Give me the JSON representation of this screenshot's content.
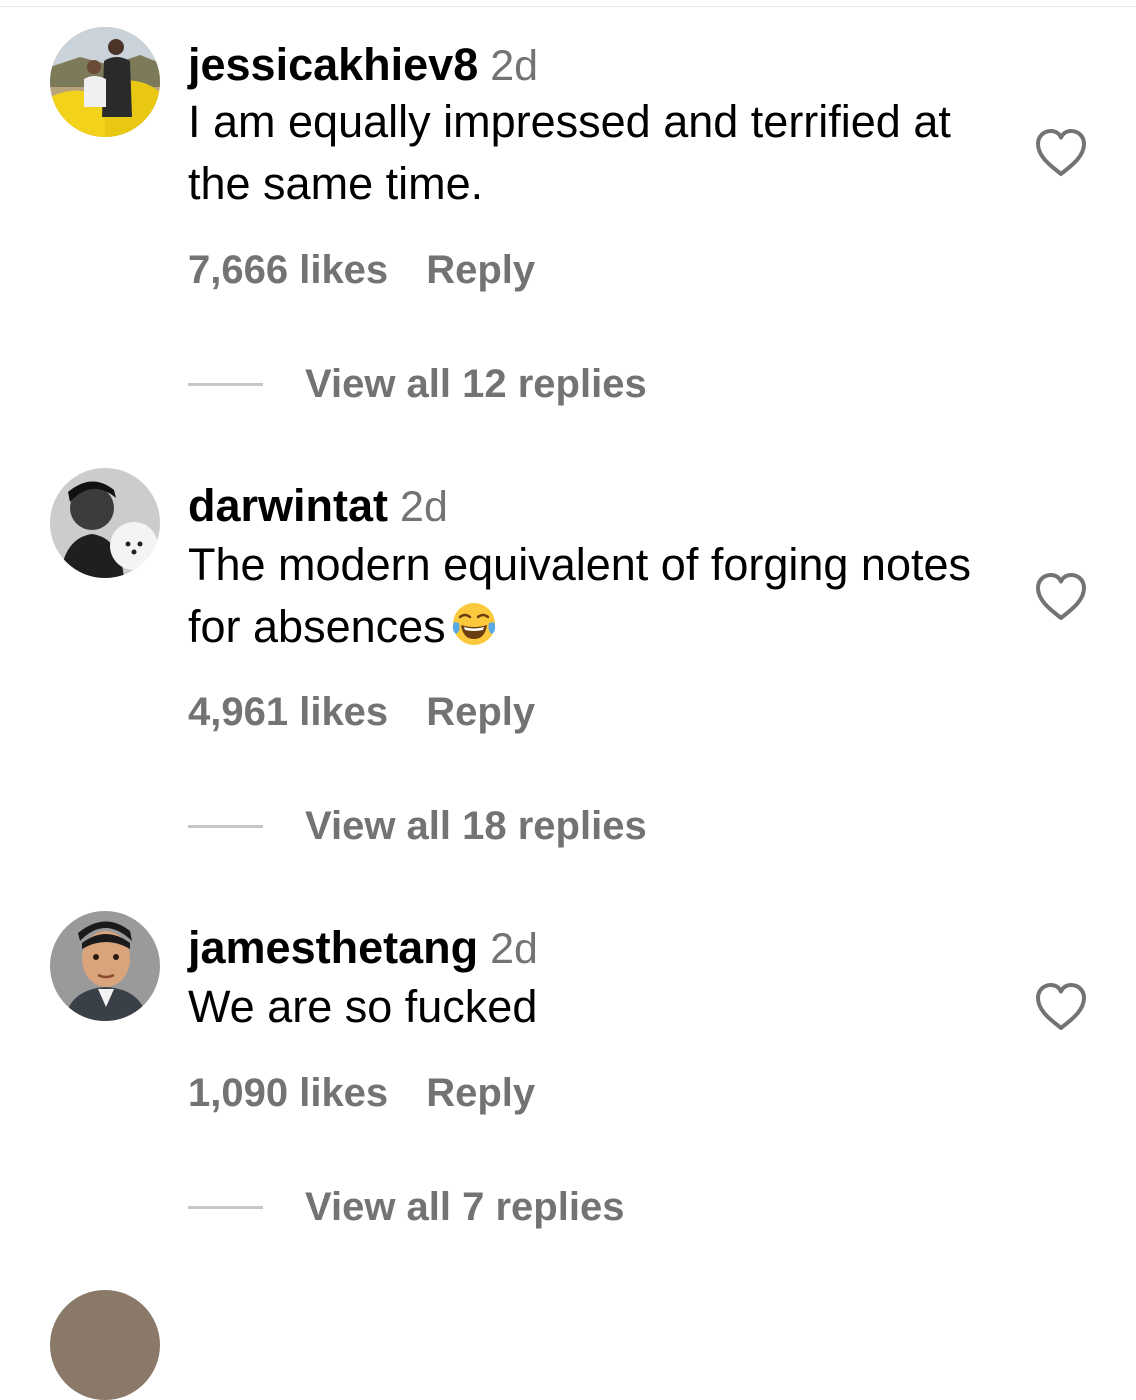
{
  "comments": [
    {
      "username": "jessicakhiev8",
      "time": "2d",
      "text": "I am equally impressed and terrified at the same time.",
      "emoji": "",
      "likes": "7,666 likes",
      "reply_label": "Reply",
      "view_replies": "View all 12 replies"
    },
    {
      "username": "darwintat",
      "time": "2d",
      "text": "The modern equivalent of forging notes for absences",
      "emoji": "😂",
      "likes": "4,961 likes",
      "reply_label": "Reply",
      "view_replies": "View all 18 replies"
    },
    {
      "username": "jamesthetang",
      "time": "2d",
      "text": "We are so fucked",
      "emoji": "",
      "likes": "1,090 likes",
      "reply_label": "Reply",
      "view_replies": "View all 7 replies"
    }
  ],
  "icons": {
    "like": "heart-outline-icon"
  },
  "colors": {
    "secondary_text": "#737373",
    "primary_text": "#000000",
    "reply_line": "#c7c7c7"
  }
}
